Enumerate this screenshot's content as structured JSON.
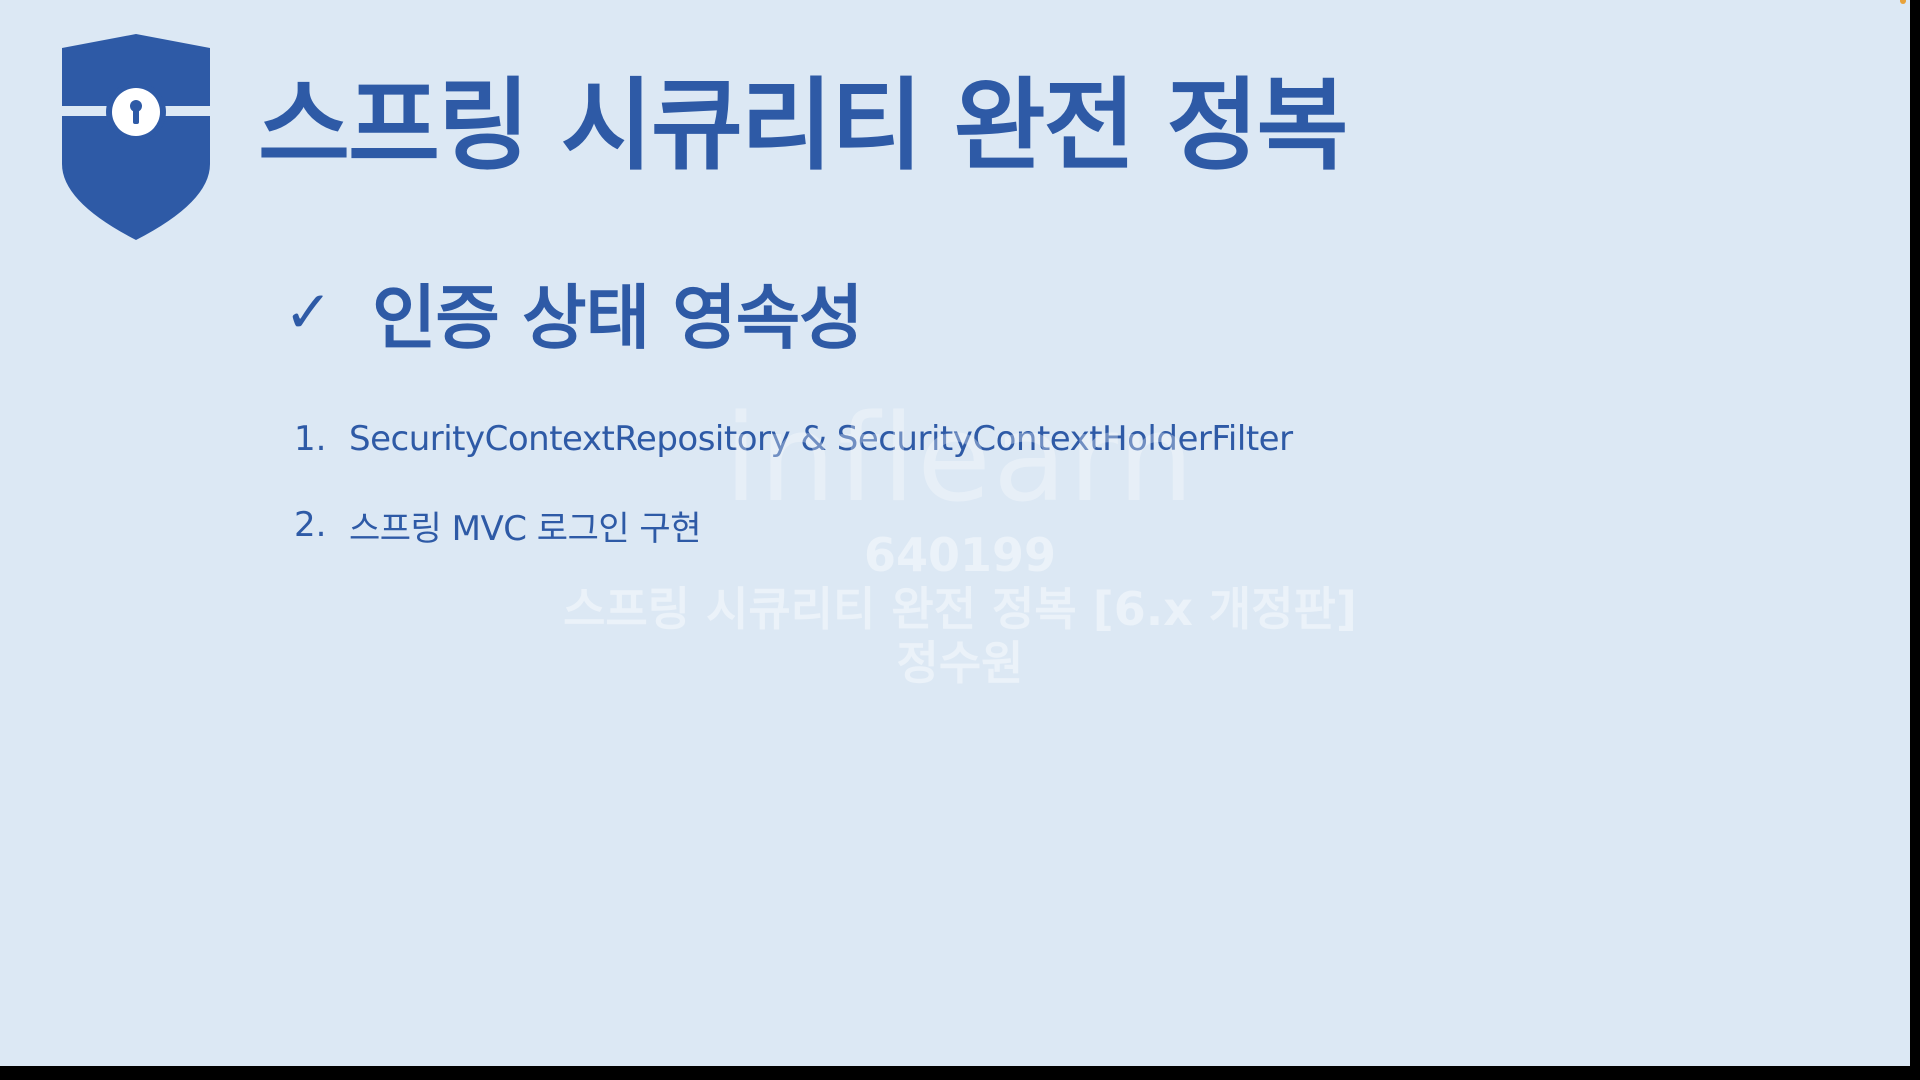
{
  "slide": {
    "title": "스프링 시큐리티 완전 정복",
    "subheading": "인증 상태 영속성",
    "check_glyph": "✓",
    "items": [
      {
        "number": "1.",
        "text": "SecurityContextRepository & SecurityContextHolderFilter"
      },
      {
        "number": "2.",
        "text": "스프링 MVC 로그인 구현"
      }
    ]
  },
  "icons": {
    "shield": "shield-keyhole-icon"
  },
  "watermark": {
    "logo": "inflearn",
    "id": "640199",
    "course": "스프링 시큐리티 완전 정복 [6.x 개정판]",
    "author": "정수원"
  },
  "colors": {
    "background": "#dce8f4",
    "primary": "#2e5aa6",
    "frame": "#000000"
  }
}
